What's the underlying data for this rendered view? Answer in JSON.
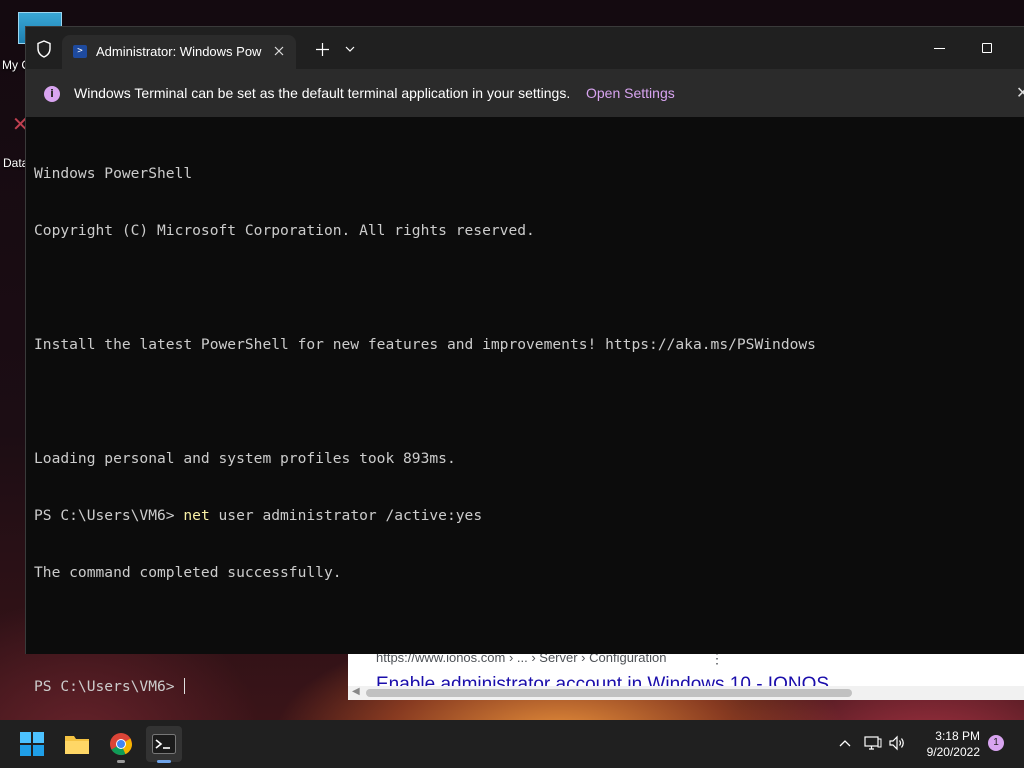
{
  "desktop": {
    "icons": [
      {
        "label": "My C"
      },
      {
        "label": "Data"
      }
    ]
  },
  "browser_peek": {
    "cite": "https://www.ionos.com › ... › Server › Configuration",
    "more": "⋮",
    "result_title": "Enable administrator account in Windows 10 - IONOS"
  },
  "terminal": {
    "tab_title": "Administrator: Windows PowerShell",
    "infobar": {
      "message": "Windows Terminal can be set as the default terminal application in your settings.",
      "link": "Open Settings"
    },
    "console": {
      "lines": [
        "Windows PowerShell",
        "Copyright (C) Microsoft Corporation. All rights reserved.",
        "",
        "Install the latest PowerShell for new features and improvements! https://aka.ms/PSWindows",
        "",
        "Loading personal and system profiles took 893ms."
      ],
      "prompt": "PS C:\\Users\\VM6> ",
      "command_keyword": "net",
      "command_rest": " user administrator /active:yes",
      "result": "The command completed successfully.",
      "blank": "",
      "prompt2": "PS C:\\Users\\VM6> "
    }
  },
  "taskbar": {
    "clock_time": "3:18 PM",
    "clock_date": "9/20/2022",
    "notification_count": "1"
  },
  "colors": {
    "accent_purple": "#d8a4f0",
    "console_bg": "#0c0c0c",
    "command_yellow": "#f9f1a5"
  }
}
